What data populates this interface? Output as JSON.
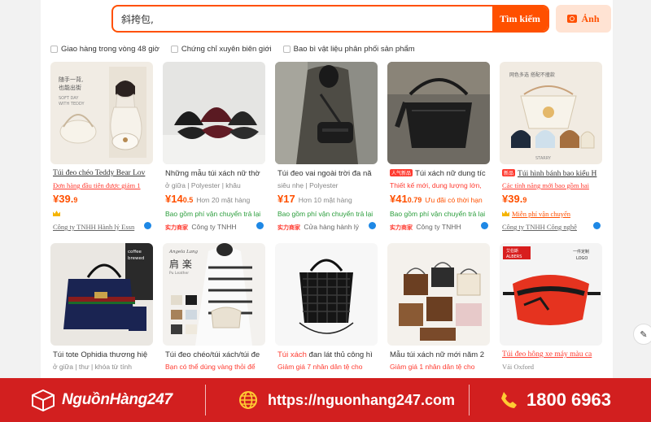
{
  "search": {
    "query": "斜挎包,",
    "button_label": "Tìm kiếm",
    "photo_label": "Ảnh"
  },
  "filters": [
    "Giao hàng trong vòng 48 giờ",
    "Chứng chỉ xuyên biên giới",
    "Bao bì vật liệu phân phối sản phẩm"
  ],
  "products_row1": [
    {
      "title": "Túi đeo chéo Teddy Bear Lov",
      "line2": "Đơn hàng đầu tiên được giảm 1",
      "price_main": "39.",
      "price_dec": "9",
      "sold": "",
      "ship": "",
      "seller": "Công ty TNHH Hành lý Essn",
      "image_text": [
        "随手一背,",
        "也能出街",
        "SOFT DAY",
        "WITH TEDDY"
      ]
    },
    {
      "title": "Những mẫu túi xách nữ thờ",
      "line2": "ở giữa | Polyester | khâu",
      "price_main": "14",
      "price_dec": "0.5",
      "sold": "Hơn 20 mặt hàng",
      "ship": "Bao gồm phí vận chuyển trả lại",
      "seller_badge": "实力商家",
      "seller": "Công ty TNHH"
    },
    {
      "title": "Túi đeo vai ngoài trời đa nă",
      "line2": "siêu nhẹ | Polyester",
      "price_main": "17",
      "price_dec": "",
      "sold": "Hơn 10 mặt hàng",
      "ship": "Bao gồm phí vận chuyển trả lại",
      "seller_badge": "实力商家",
      "seller": "Cửa hàng hành lý"
    },
    {
      "tag": "人气新品",
      "title": "Túi xách nữ dung tíc",
      "line2": "Thiết kế mới, dung lượng lớn,",
      "price_main": "41",
      "price_dec": "0.79",
      "sold": "Ưu đãi có thời hạn",
      "ship": "Bao gồm phí vận chuyển trả lại",
      "seller_badge": "实力商家",
      "seller": "Công ty TNHH"
    },
    {
      "tag": "新品",
      "title": "Túi hình bánh bao kiểu H",
      "line2": "Các tính năng mới bao gồm hai",
      "price_main": "39.",
      "price_dec": "9",
      "sold": "",
      "ship": "Miễn phí vận chuyển",
      "seller": "Công ty TNHH Công nghệ",
      "image_text": [
        "网色多选 搭配不撞款",
        "STARRY"
      ]
    }
  ],
  "products_row2": [
    {
      "title": "Túi tote Ophidia thương hiệ",
      "line2": "ở giữa | thư | khóa từ tính",
      "image_text": [
        "coffee",
        "brewed"
      ]
    },
    {
      "title": "Túi đeo chéo/túi xách/túi đe",
      "line2": "Bạn có thể dùng vàng thỏi để",
      "image_text": [
        "Angela Lang",
        "肩 楽",
        "Pu Leather"
      ]
    },
    {
      "title_red": "Túi xách",
      "title": " đan lát thủ công hì",
      "line2": "Giảm giá 7 nhân dân tệ cho"
    },
    {
      "title": "Mẫu túi xách nữ mới năm 2",
      "line2": "Giảm giá 1 nhân dân tệ cho"
    },
    {
      "title": "Túi đeo hông xe máy màu ca",
      "line2": "Vải Oxford",
      "image_text": [
        "艾伯斯",
        "ALBERS",
        "一件定制",
        "LOGO"
      ]
    }
  ],
  "banner": {
    "brand": "NguồnHàng247",
    "url": "https://nguonhang247.com",
    "phone": "1800 6963"
  },
  "colors": {
    "accent": "#ff5000",
    "banner": "#d21f1f",
    "price": "#ff5000"
  }
}
